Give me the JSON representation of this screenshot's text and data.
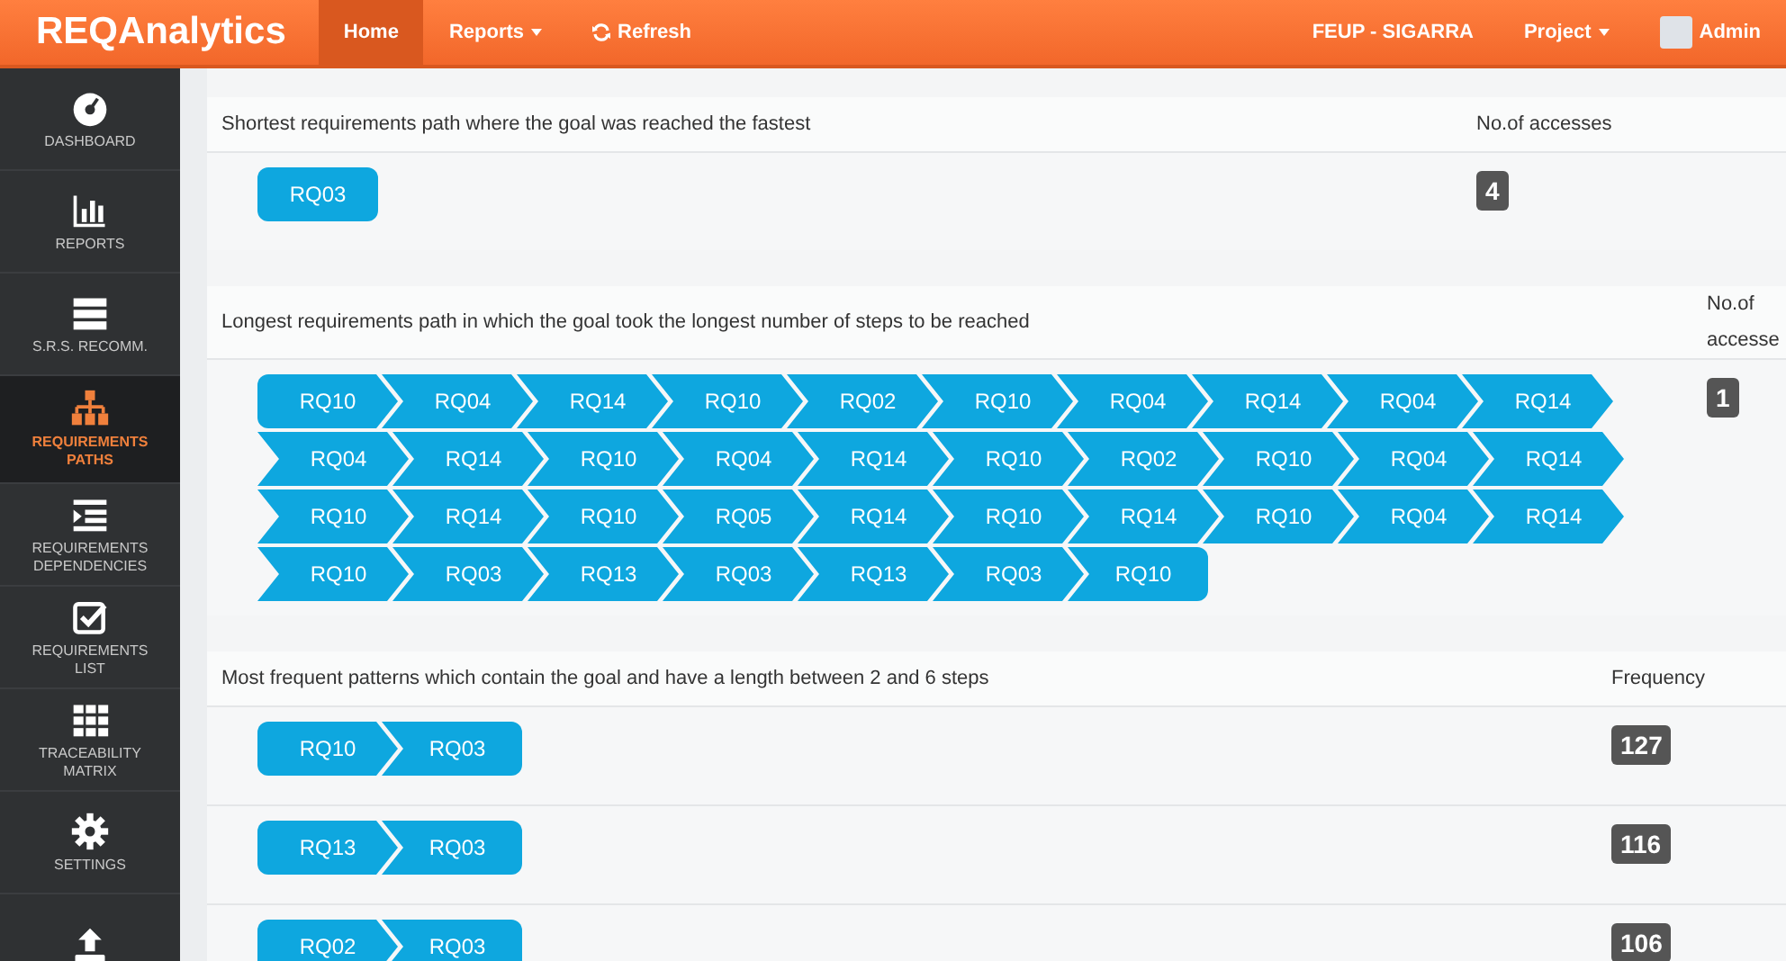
{
  "navbar": {
    "brand": "REQAnalytics",
    "items": [
      {
        "label": "Home",
        "kind": "plain",
        "selected": true
      },
      {
        "label": "Reports",
        "kind": "dropdown",
        "selected": false
      },
      {
        "label": "Refresh",
        "kind": "refresh",
        "selected": false
      }
    ],
    "right_items": [
      {
        "label": "FEUP - SIGARRA",
        "kind": "plain"
      },
      {
        "label": "Project",
        "kind": "dropdown"
      },
      {
        "label": "Admin",
        "kind": "user"
      }
    ]
  },
  "sidebar": {
    "items": [
      {
        "label": "DASHBOARD",
        "selected": false
      },
      {
        "label": "REPORTS",
        "selected": false
      },
      {
        "label": "S.R.S. RECOMM.",
        "selected": false
      },
      {
        "label": "REQUIREMENTS PATHS",
        "selected": true
      },
      {
        "label": "REQUIREMENTS DEPENDENCIES",
        "selected": false
      },
      {
        "label": "REQUIREMENTS LIST",
        "selected": false
      },
      {
        "label": "TRACEABILITY MATRIX",
        "selected": false
      },
      {
        "label": "SETTINGS",
        "selected": false
      },
      {
        "selected": false
      }
    ]
  },
  "sections": [
    {
      "title": "Shortest requirements path where the goal was reached the fastest",
      "count_label": "No.of accesses",
      "rows": [
        {
          "steps": [
            "RQ03"
          ],
          "count": "4"
        }
      ]
    },
    {
      "title": "Longest requirements path in which the goal took the longest number of steps to be reached",
      "count_label": "No.of accesse",
      "rows": [
        {
          "steps": [
            "RQ10",
            "RQ04",
            "RQ14",
            "RQ10",
            "RQ02",
            "RQ10",
            "RQ04",
            "RQ14",
            "RQ04",
            "RQ14",
            "RQ04",
            "RQ14",
            "RQ10",
            "RQ04",
            "RQ14",
            "RQ10",
            "RQ02",
            "RQ10",
            "RQ04",
            "RQ14",
            "RQ10",
            "RQ14",
            "RQ10",
            "RQ05",
            "RQ14",
            "RQ10",
            "RQ14",
            "RQ10",
            "RQ04",
            "RQ14",
            "RQ10",
            "RQ03",
            "RQ13",
            "RQ03",
            "RQ13",
            "RQ03",
            "RQ10"
          ],
          "count": "1"
        }
      ]
    },
    {
      "title": "Most frequent patterns which contain the goal and have a length between 2 and 6 steps",
      "count_label": "Frequency",
      "rows": [
        {
          "steps": [
            "RQ10",
            "RQ03"
          ],
          "count": "127"
        },
        {
          "steps": [
            "RQ13",
            "RQ03"
          ],
          "count": "116"
        },
        {
          "steps": [
            "RQ02",
            "RQ03"
          ],
          "count": "106"
        }
      ]
    }
  ]
}
